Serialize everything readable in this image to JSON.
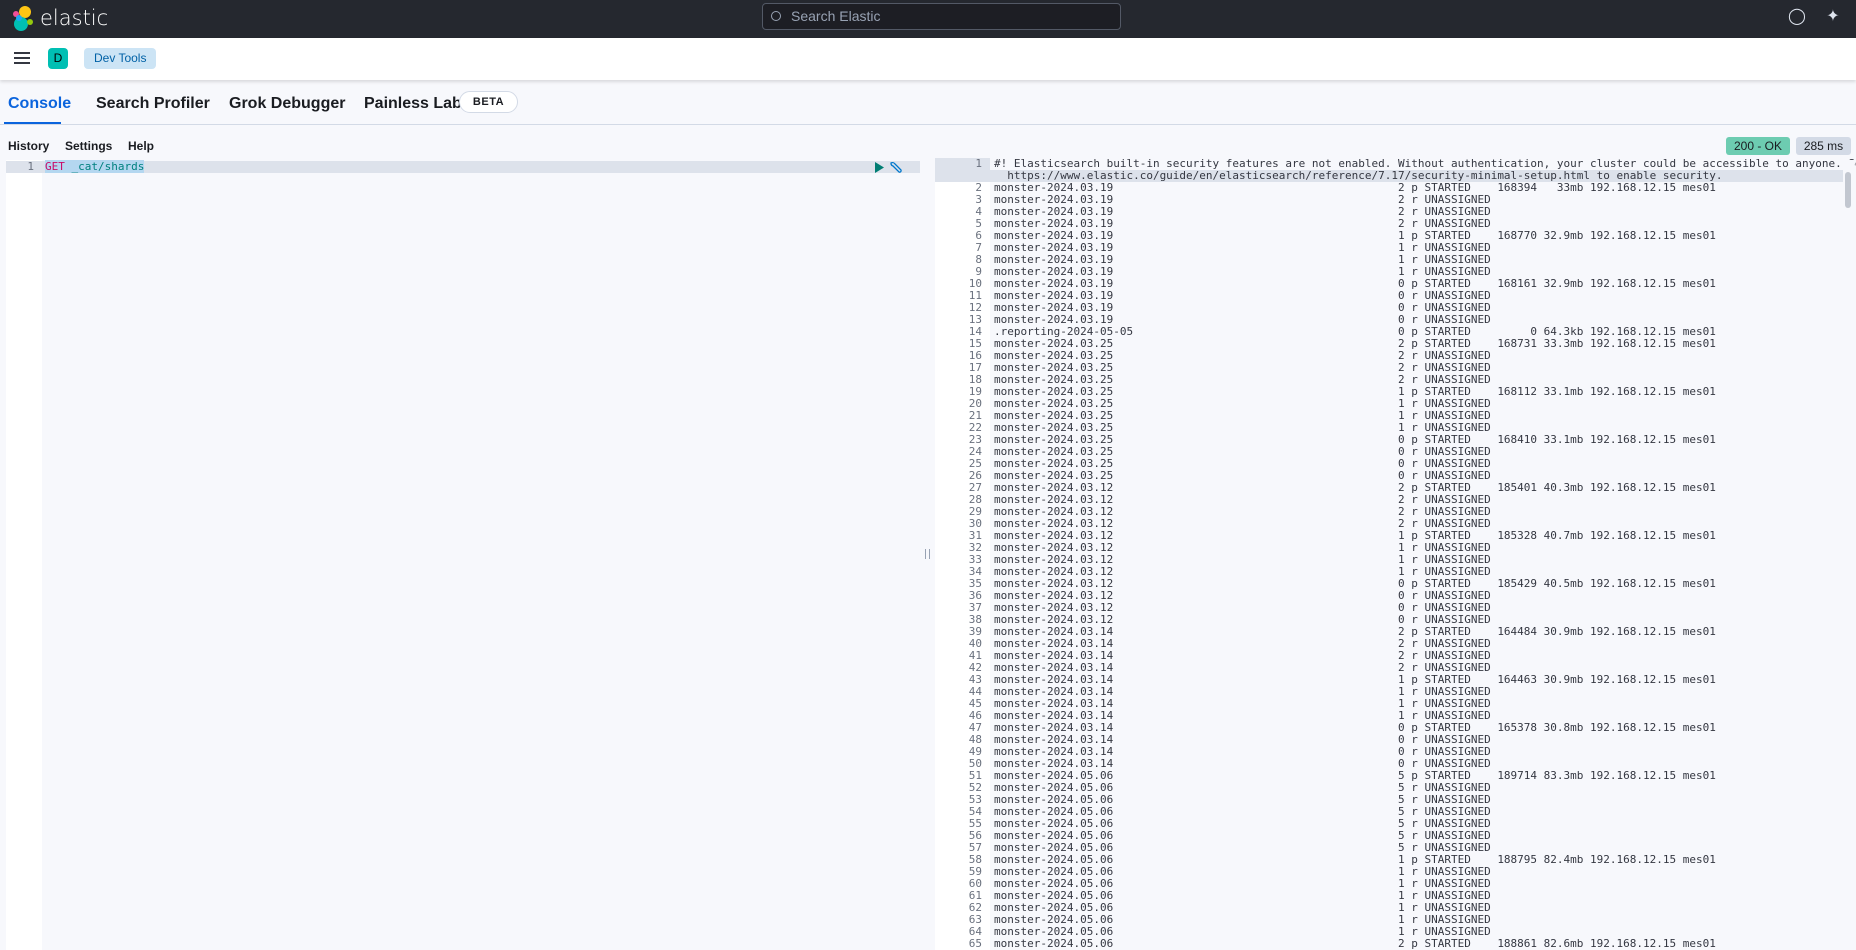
{
  "header": {
    "brand": "elastic",
    "search_placeholder": "Search Elastic",
    "help_icon": "help-icon",
    "news_icon": "newsfeed-icon"
  },
  "nav": {
    "avatar": "D",
    "breadcrumb": "Dev Tools"
  },
  "tabs": [
    {
      "label": "Console",
      "active": true
    },
    {
      "label": "Search Profiler"
    },
    {
      "label": "Grok Debugger"
    },
    {
      "label": "Painless Lab"
    }
  ],
  "beta_badge": "BETA",
  "toolbar": {
    "history": "History",
    "settings": "Settings",
    "help": "Help"
  },
  "status": {
    "code": "200 - OK",
    "time": "285 ms",
    "ok_color": "#6dccb1"
  },
  "request": {
    "line_number": "1",
    "method": "GET",
    "path": "_cat/shards"
  },
  "response": {
    "warning_line1": "#! Elasticsearch built-in security features are not enabled. Without authentication, your cluster could be accessible to anyone. See",
    "warning_line2": "  https://www.elastic.co/guide/en/elasticsearch/reference/7.17/security-minimal-setup.html to enable security.",
    "rows": [
      [
        "monster-2024.03.19",
        "2",
        "p",
        "STARTED",
        "168394",
        "33mb",
        "192.168.12.15",
        "mes01"
      ],
      [
        "monster-2024.03.19",
        "2",
        "r",
        "UNASSIGNED",
        "",
        "",
        "",
        ""
      ],
      [
        "monster-2024.03.19",
        "2",
        "r",
        "UNASSIGNED",
        "",
        "",
        "",
        ""
      ],
      [
        "monster-2024.03.19",
        "2",
        "r",
        "UNASSIGNED",
        "",
        "",
        "",
        ""
      ],
      [
        "monster-2024.03.19",
        "1",
        "p",
        "STARTED",
        "168770",
        "32.9mb",
        "192.168.12.15",
        "mes01"
      ],
      [
        "monster-2024.03.19",
        "1",
        "r",
        "UNASSIGNED",
        "",
        "",
        "",
        ""
      ],
      [
        "monster-2024.03.19",
        "1",
        "r",
        "UNASSIGNED",
        "",
        "",
        "",
        ""
      ],
      [
        "monster-2024.03.19",
        "1",
        "r",
        "UNASSIGNED",
        "",
        "",
        "",
        ""
      ],
      [
        "monster-2024.03.19",
        "0",
        "p",
        "STARTED",
        "168161",
        "32.9mb",
        "192.168.12.15",
        "mes01"
      ],
      [
        "monster-2024.03.19",
        "0",
        "r",
        "UNASSIGNED",
        "",
        "",
        "",
        ""
      ],
      [
        "monster-2024.03.19",
        "0",
        "r",
        "UNASSIGNED",
        "",
        "",
        "",
        ""
      ],
      [
        "monster-2024.03.19",
        "0",
        "r",
        "UNASSIGNED",
        "",
        "",
        "",
        ""
      ],
      [
        ".reporting-2024-05-05",
        "0",
        "p",
        "STARTED",
        "0",
        "64.3kb",
        "192.168.12.15",
        "mes01"
      ],
      [
        "monster-2024.03.25",
        "2",
        "p",
        "STARTED",
        "168731",
        "33.3mb",
        "192.168.12.15",
        "mes01"
      ],
      [
        "monster-2024.03.25",
        "2",
        "r",
        "UNASSIGNED",
        "",
        "",
        "",
        ""
      ],
      [
        "monster-2024.03.25",
        "2",
        "r",
        "UNASSIGNED",
        "",
        "",
        "",
        ""
      ],
      [
        "monster-2024.03.25",
        "2",
        "r",
        "UNASSIGNED",
        "",
        "",
        "",
        ""
      ],
      [
        "monster-2024.03.25",
        "1",
        "p",
        "STARTED",
        "168112",
        "33.1mb",
        "192.168.12.15",
        "mes01"
      ],
      [
        "monster-2024.03.25",
        "1",
        "r",
        "UNASSIGNED",
        "",
        "",
        "",
        ""
      ],
      [
        "monster-2024.03.25",
        "1",
        "r",
        "UNASSIGNED",
        "",
        "",
        "",
        ""
      ],
      [
        "monster-2024.03.25",
        "1",
        "r",
        "UNASSIGNED",
        "",
        "",
        "",
        ""
      ],
      [
        "monster-2024.03.25",
        "0",
        "p",
        "STARTED",
        "168410",
        "33.1mb",
        "192.168.12.15",
        "mes01"
      ],
      [
        "monster-2024.03.25",
        "0",
        "r",
        "UNASSIGNED",
        "",
        "",
        "",
        ""
      ],
      [
        "monster-2024.03.25",
        "0",
        "r",
        "UNASSIGNED",
        "",
        "",
        "",
        ""
      ],
      [
        "monster-2024.03.25",
        "0",
        "r",
        "UNASSIGNED",
        "",
        "",
        "",
        ""
      ],
      [
        "monster-2024.03.12",
        "2",
        "p",
        "STARTED",
        "185401",
        "40.3mb",
        "192.168.12.15",
        "mes01"
      ],
      [
        "monster-2024.03.12",
        "2",
        "r",
        "UNASSIGNED",
        "",
        "",
        "",
        ""
      ],
      [
        "monster-2024.03.12",
        "2",
        "r",
        "UNASSIGNED",
        "",
        "",
        "",
        ""
      ],
      [
        "monster-2024.03.12",
        "2",
        "r",
        "UNASSIGNED",
        "",
        "",
        "",
        ""
      ],
      [
        "monster-2024.03.12",
        "1",
        "p",
        "STARTED",
        "185328",
        "40.7mb",
        "192.168.12.15",
        "mes01"
      ],
      [
        "monster-2024.03.12",
        "1",
        "r",
        "UNASSIGNED",
        "",
        "",
        "",
        ""
      ],
      [
        "monster-2024.03.12",
        "1",
        "r",
        "UNASSIGNED",
        "",
        "",
        "",
        ""
      ],
      [
        "monster-2024.03.12",
        "1",
        "r",
        "UNASSIGNED",
        "",
        "",
        "",
        ""
      ],
      [
        "monster-2024.03.12",
        "0",
        "p",
        "STARTED",
        "185429",
        "40.5mb",
        "192.168.12.15",
        "mes01"
      ],
      [
        "monster-2024.03.12",
        "0",
        "r",
        "UNASSIGNED",
        "",
        "",
        "",
        ""
      ],
      [
        "monster-2024.03.12",
        "0",
        "r",
        "UNASSIGNED",
        "",
        "",
        "",
        ""
      ],
      [
        "monster-2024.03.12",
        "0",
        "r",
        "UNASSIGNED",
        "",
        "",
        "",
        ""
      ],
      [
        "monster-2024.03.14",
        "2",
        "p",
        "STARTED",
        "164484",
        "30.9mb",
        "192.168.12.15",
        "mes01"
      ],
      [
        "monster-2024.03.14",
        "2",
        "r",
        "UNASSIGNED",
        "",
        "",
        "",
        ""
      ],
      [
        "monster-2024.03.14",
        "2",
        "r",
        "UNASSIGNED",
        "",
        "",
        "",
        ""
      ],
      [
        "monster-2024.03.14",
        "2",
        "r",
        "UNASSIGNED",
        "",
        "",
        "",
        ""
      ],
      [
        "monster-2024.03.14",
        "1",
        "p",
        "STARTED",
        "164463",
        "30.9mb",
        "192.168.12.15",
        "mes01"
      ],
      [
        "monster-2024.03.14",
        "1",
        "r",
        "UNASSIGNED",
        "",
        "",
        "",
        ""
      ],
      [
        "monster-2024.03.14",
        "1",
        "r",
        "UNASSIGNED",
        "",
        "",
        "",
        ""
      ],
      [
        "monster-2024.03.14",
        "1",
        "r",
        "UNASSIGNED",
        "",
        "",
        "",
        ""
      ],
      [
        "monster-2024.03.14",
        "0",
        "p",
        "STARTED",
        "165378",
        "30.8mb",
        "192.168.12.15",
        "mes01"
      ],
      [
        "monster-2024.03.14",
        "0",
        "r",
        "UNASSIGNED",
        "",
        "",
        "",
        ""
      ],
      [
        "monster-2024.03.14",
        "0",
        "r",
        "UNASSIGNED",
        "",
        "",
        "",
        ""
      ],
      [
        "monster-2024.03.14",
        "0",
        "r",
        "UNASSIGNED",
        "",
        "",
        "",
        ""
      ],
      [
        "monster-2024.05.06",
        "5",
        "p",
        "STARTED",
        "189714",
        "83.3mb",
        "192.168.12.15",
        "mes01"
      ],
      [
        "monster-2024.05.06",
        "5",
        "r",
        "UNASSIGNED",
        "",
        "",
        "",
        ""
      ],
      [
        "monster-2024.05.06",
        "5",
        "r",
        "UNASSIGNED",
        "",
        "",
        "",
        ""
      ],
      [
        "monster-2024.05.06",
        "5",
        "r",
        "UNASSIGNED",
        "",
        "",
        "",
        ""
      ],
      [
        "monster-2024.05.06",
        "5",
        "r",
        "UNASSIGNED",
        "",
        "",
        "",
        ""
      ],
      [
        "monster-2024.05.06",
        "5",
        "r",
        "UNASSIGNED",
        "",
        "",
        "",
        ""
      ],
      [
        "monster-2024.05.06",
        "5",
        "r",
        "UNASSIGNED",
        "",
        "",
        "",
        ""
      ],
      [
        "monster-2024.05.06",
        "1",
        "p",
        "STARTED",
        "188795",
        "82.4mb",
        "192.168.12.15",
        "mes01"
      ],
      [
        "monster-2024.05.06",
        "1",
        "r",
        "UNASSIGNED",
        "",
        "",
        "",
        ""
      ],
      [
        "monster-2024.05.06",
        "1",
        "r",
        "UNASSIGNED",
        "",
        "",
        "",
        ""
      ],
      [
        "monster-2024.05.06",
        "1",
        "r",
        "UNASSIGNED",
        "",
        "",
        "",
        ""
      ],
      [
        "monster-2024.05.06",
        "1",
        "r",
        "UNASSIGNED",
        "",
        "",
        "",
        ""
      ],
      [
        "monster-2024.05.06",
        "1",
        "r",
        "UNASSIGNED",
        "",
        "",
        "",
        ""
      ],
      [
        "monster-2024.05.06",
        "1",
        "r",
        "UNASSIGNED",
        "",
        "",
        "",
        ""
      ],
      [
        "monster-2024.05.06",
        "2",
        "p",
        "STARTED",
        "188861",
        "82.6mb",
        "192.168.12.15",
        "mes01"
      ]
    ]
  }
}
